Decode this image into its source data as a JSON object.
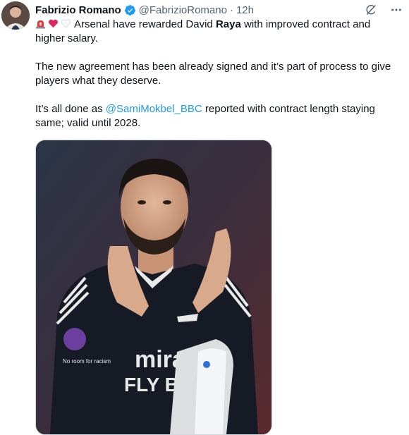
{
  "author": {
    "name": "Fabrizio Romano",
    "handle": "@FabrizioRomano",
    "separator": "·",
    "time": "12h"
  },
  "post": {
    "emojis": [
      "rotating-light",
      "red-heart",
      "white-heart"
    ],
    "line1_before": "Arsenal have rewarded David ",
    "line1_bold": "Raya",
    "line1_after": " with improved contract and higher salary.",
    "para2": "The new agreement has been already signed and it’s part of process to give players what they deserve.",
    "para3_before": "It’s all done as ",
    "para3_mention": "@SamiMokbel_BBC",
    "para3_after": " reported with contract length staying same; valid until 2028."
  },
  "media": {
    "shirt_sponsor_line1": "mira",
    "shirt_sponsor_line2": "FLY B",
    "badge_text": "No room for racism"
  },
  "colors": {
    "link": "#1d9bf0",
    "secondary_text": "#536471",
    "verified": "#1d9bf0"
  }
}
